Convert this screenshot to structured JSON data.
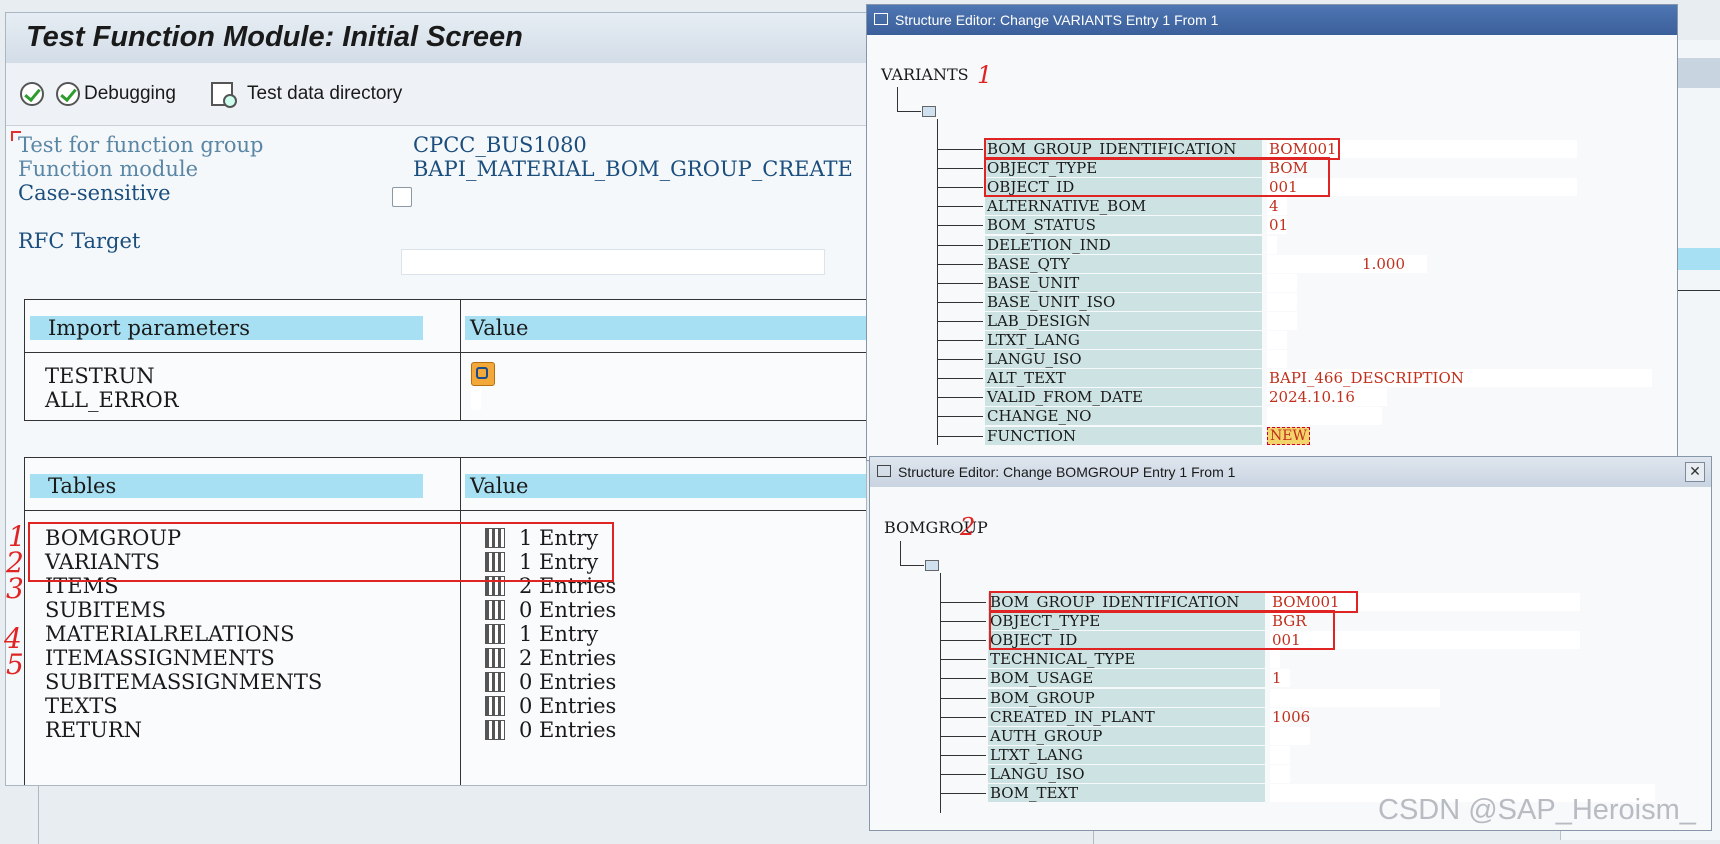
{
  "main": {
    "title": "Test Function Module: Initial Screen",
    "toolbar": {
      "debugging": "Debugging",
      "test_dir": "Test data directory"
    },
    "fields": [
      {
        "label": "Test for function group",
        "value": "CPCC_BUS1080"
      },
      {
        "label": "Function module",
        "value": "BAPI_MATERIAL_BOM_GROUP_CREATE"
      },
      {
        "label": "Case-sensitive",
        "value": ""
      },
      {
        "label": "RFC Target",
        "value": ""
      }
    ],
    "import": {
      "header": "Import parameters",
      "value_header": "Value",
      "rows": [
        "TESTRUN",
        "ALL_ERROR"
      ]
    },
    "tables": {
      "header": "Tables",
      "value_header": "Value",
      "rows": [
        {
          "name": "BOMGROUP",
          "value": "1 Entry"
        },
        {
          "name": "VARIANTS",
          "value": "1 Entry"
        },
        {
          "name": "ITEMS",
          "value": "2 Entries"
        },
        {
          "name": "SUBITEMS",
          "value": "0 Entries"
        },
        {
          "name": "MATERIALRELATIONS",
          "value": "1 Entry"
        },
        {
          "name": "ITEMASSIGNMENTS",
          "value": "2 Entries"
        },
        {
          "name": "SUBITEMASSIGNMENTS",
          "value": "0 Entries"
        },
        {
          "name": "TEXTS",
          "value": "0 Entries"
        },
        {
          "name": "RETURN",
          "value": "0 Entries"
        }
      ]
    }
  },
  "variants_editor": {
    "title": "Structure Editor: Change VARIANTS Entry 1 From 1",
    "root": "VARIANTS",
    "fields": [
      {
        "key": "BOM_GROUP_IDENTIFICATION",
        "value": "BOM001"
      },
      {
        "key": "OBJECT_TYPE",
        "value": "BOM"
      },
      {
        "key": "OBJECT_ID",
        "value": "001"
      },
      {
        "key": "ALTERNATIVE_BOM",
        "value": "4"
      },
      {
        "key": "BOM_STATUS",
        "value": "01"
      },
      {
        "key": "DELETION_IND",
        "value": ""
      },
      {
        "key": "BASE_QTY",
        "value": "1.000"
      },
      {
        "key": "BASE_UNIT",
        "value": ""
      },
      {
        "key": "BASE_UNIT_ISO",
        "value": ""
      },
      {
        "key": "LAB_DESIGN",
        "value": ""
      },
      {
        "key": "LTXT_LANG",
        "value": ""
      },
      {
        "key": "LANGU_ISO",
        "value": ""
      },
      {
        "key": "ALT_TEXT",
        "value": "BAPI_466_DESCRIPTION"
      },
      {
        "key": "VALID_FROM_DATE",
        "value": "2024.10.16"
      },
      {
        "key": "CHANGE_NO",
        "value": ""
      },
      {
        "key": "FUNCTION",
        "value": "NEW"
      }
    ]
  },
  "bomgroup_editor": {
    "title": "Structure Editor: Change BOMGROUP Entry 1 From 1",
    "root": "BOMGROUP",
    "fields": [
      {
        "key": "BOM_GROUP_IDENTIFICATION",
        "value": "BOM001"
      },
      {
        "key": "OBJECT_TYPE",
        "value": "BGR"
      },
      {
        "key": "OBJECT_ID",
        "value": "001"
      },
      {
        "key": "TECHNICAL_TYPE",
        "value": ""
      },
      {
        "key": "BOM_USAGE",
        "value": "1"
      },
      {
        "key": "BOM_GROUP",
        "value": ""
      },
      {
        "key": "CREATED_IN_PLANT",
        "value": "1006"
      },
      {
        "key": "AUTH_GROUP",
        "value": ""
      },
      {
        "key": "LTXT_LANG",
        "value": ""
      },
      {
        "key": "LANGU_ISO",
        "value": ""
      },
      {
        "key": "BOM_TEXT",
        "value": ""
      }
    ]
  },
  "annotations": {
    "n1": "1",
    "n2": "2",
    "n3": "3",
    "n4": "4",
    "n5": "5",
    "v1": "1",
    "b2": "2"
  },
  "watermark": "CSDN @SAP_Heroism_",
  "colors": {
    "header_cell": "#a6e0f2",
    "key_cell": "#cde3e3",
    "annotation": "#e02424",
    "editor_title": "#3b5f9a"
  }
}
